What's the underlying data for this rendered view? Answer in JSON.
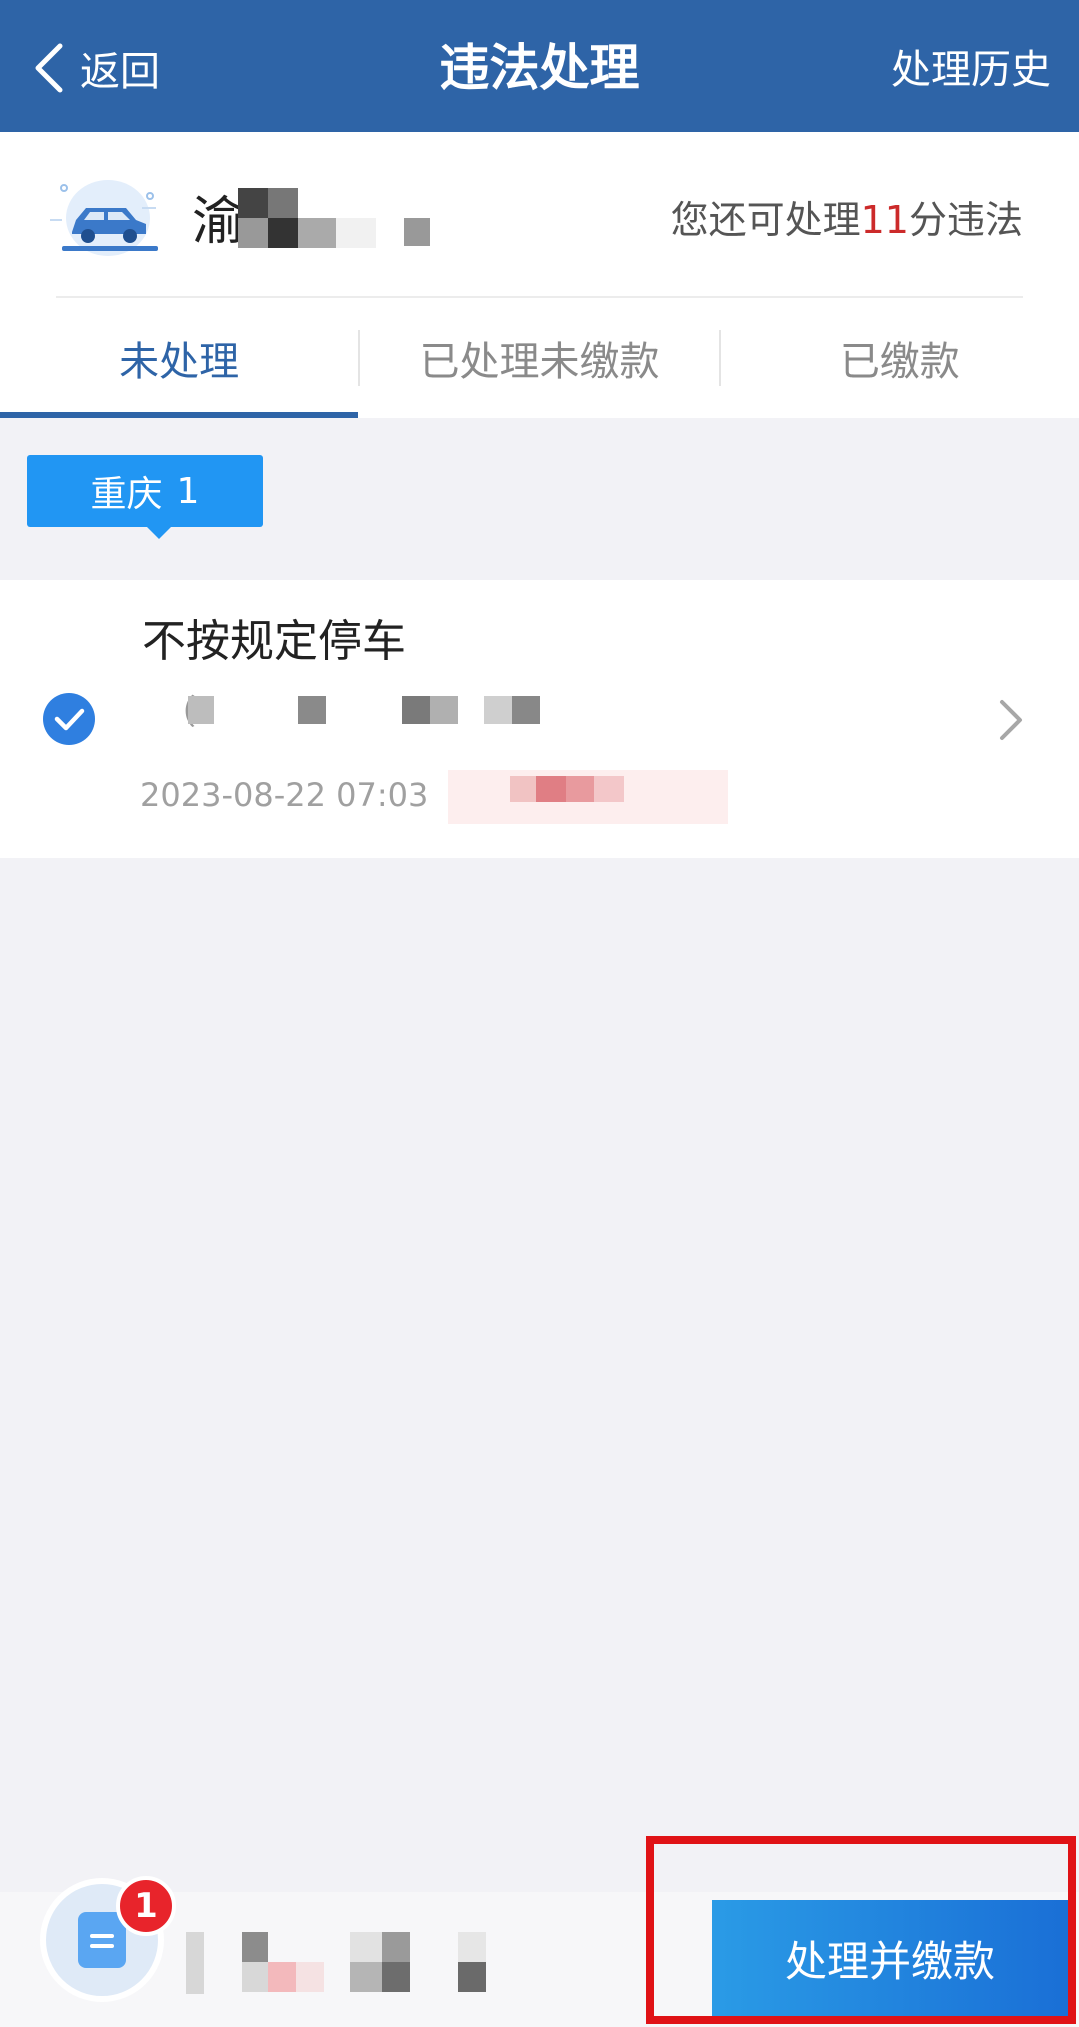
{
  "header": {
    "back_label": "返回",
    "title": "违法处理",
    "history_label": "处理历史"
  },
  "plate": {
    "prefix": "渝",
    "quota_prefix": "您还可处理",
    "quota_points": "11",
    "quota_suffix": "分违法"
  },
  "tabs": [
    {
      "label": "未处理",
      "active": true
    },
    {
      "label": "已处理未缴款",
      "active": false
    },
    {
      "label": "已缴款",
      "active": false
    }
  ],
  "region": {
    "name": "重庆",
    "count": "1"
  },
  "violations": [
    {
      "title": "不按规定停车",
      "code_prefix": "（",
      "time": "2023-08-22 07:03",
      "selected": true
    }
  ],
  "bottom": {
    "badge_count": "1",
    "pay_button_label": "处理并缴款"
  },
  "colors": {
    "header": "#2e64a7",
    "accent": "#2196f3",
    "points": "#cc2a2a",
    "badge": "#e8242b",
    "highlight": "#e01216"
  },
  "icons": {
    "back": "chevron-left-icon",
    "car": "car-icon",
    "check": "check-circle-icon",
    "chevron": "chevron-right-icon",
    "doc": "document-list-icon"
  }
}
